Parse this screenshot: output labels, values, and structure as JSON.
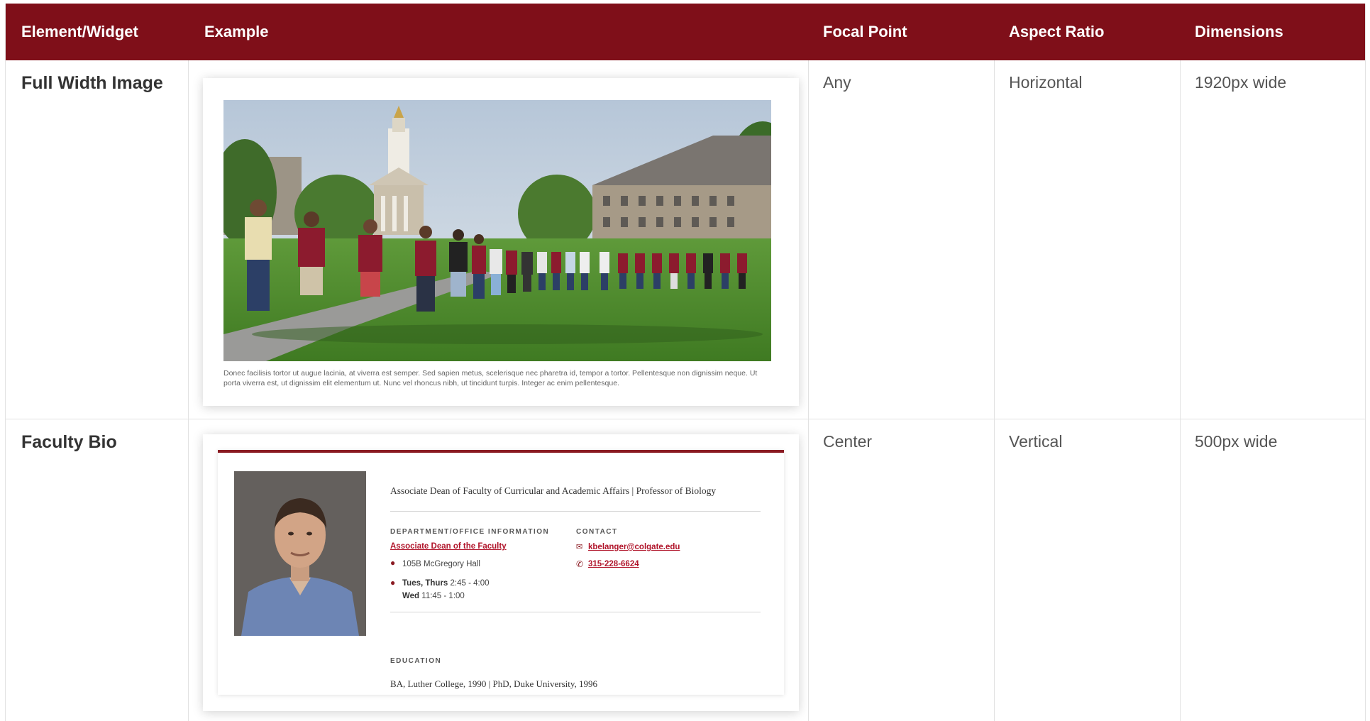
{
  "header": {
    "col1": "Element/Widget",
    "col2": "Example",
    "col3": "Focal Point",
    "col4": "Aspect Ratio",
    "col5": "Dimensions"
  },
  "rows": [
    {
      "title": "Full Width Image",
      "focal_point": "Any",
      "aspect_ratio": "Horizontal",
      "dimensions": "1920px wide",
      "caption": "Donec facilisis tortor ut augue lacinia, at viverra est semper. Sed sapien metus, scelerisque nec pharetra id, tempor a tortor. Pellentesque non dignissim neque. Ut porta viverra est, ut dignissim elit elementum ut. Nunc vel rhoncus nibh, ut tincidunt turpis. Integer ac enim pellentesque."
    },
    {
      "title": "Faculty Bio",
      "focal_point": "Center",
      "aspect_ratio": "Vertical",
      "dimensions": "500px wide",
      "bio": {
        "job_title": "Associate Dean of Faculty of Curricular and Academic Affairs | Professor of Biology",
        "dept_heading": "DEPARTMENT/OFFICE INFORMATION",
        "dept_link": "Associate Dean of the Faculty",
        "location": "105B McGregory Hall",
        "hours_line1_days": "Tues, Thurs",
        "hours_line1_time": "2:45 - 4:00",
        "hours_line2_days": "Wed",
        "hours_line2_time": "11:45 - 1:00",
        "contact_heading": "CONTACT",
        "email": "kbelanger@colgate.edu",
        "phone": "315-228-6624",
        "education_heading": "EDUCATION",
        "education": "BA, Luther College, 1990 | PhD, Duke University, 1996"
      }
    }
  ],
  "colors": {
    "header_bg": "#7f0f19",
    "accent": "#8a1a22",
    "link": "#b0142a"
  }
}
